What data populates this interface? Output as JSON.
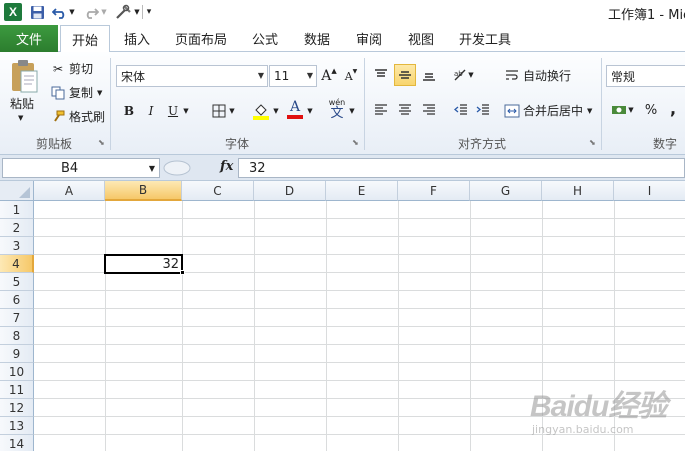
{
  "title_bar": {
    "title": "工作簿1 - Mic",
    "excel_logo": "X"
  },
  "tabs": {
    "file": "文件",
    "items": [
      "开始",
      "插入",
      "页面布局",
      "公式",
      "数据",
      "审阅",
      "视图",
      "开发工具"
    ],
    "active": "开始"
  },
  "ribbon": {
    "clipboard": {
      "paste": "粘贴",
      "cut": "剪切",
      "copy": "复制",
      "format_painter": "格式刷",
      "label": "剪贴板"
    },
    "font": {
      "font_name": "宋体",
      "font_size": "11",
      "grow": "A",
      "shrink": "A",
      "bold": "B",
      "italic": "I",
      "underline": "U",
      "font_color_letter": "A",
      "phonetic": "wén",
      "phonetic_char": "文",
      "label": "字体",
      "fill_color": "#ffff00",
      "font_color": "#e01010"
    },
    "alignment": {
      "wrap_text": "自动换行",
      "merge_center": "合并后居中",
      "label": "对齐方式"
    },
    "number": {
      "format": "常规",
      "percent": "%",
      "comma": ",",
      "label": "数字"
    }
  },
  "formula_bar": {
    "name_box": "B4",
    "fx": "fx",
    "value": "32"
  },
  "grid": {
    "columns": [
      "A",
      "B",
      "C",
      "D",
      "E",
      "F",
      "G",
      "H",
      "I"
    ],
    "rows": [
      "1",
      "2",
      "3",
      "4",
      "5",
      "6",
      "7",
      "8",
      "9",
      "10",
      "11",
      "12",
      "13",
      "14"
    ],
    "selected_column": "B",
    "selected_row": "4",
    "cell_b4": "32"
  },
  "watermark": {
    "main": "Baidu经验",
    "sub": "jingyan.baidu.com"
  },
  "colors": {
    "file_tab": "#2c7d2e",
    "selection_header": "#f6c869",
    "gridline": "#dadcdd"
  }
}
